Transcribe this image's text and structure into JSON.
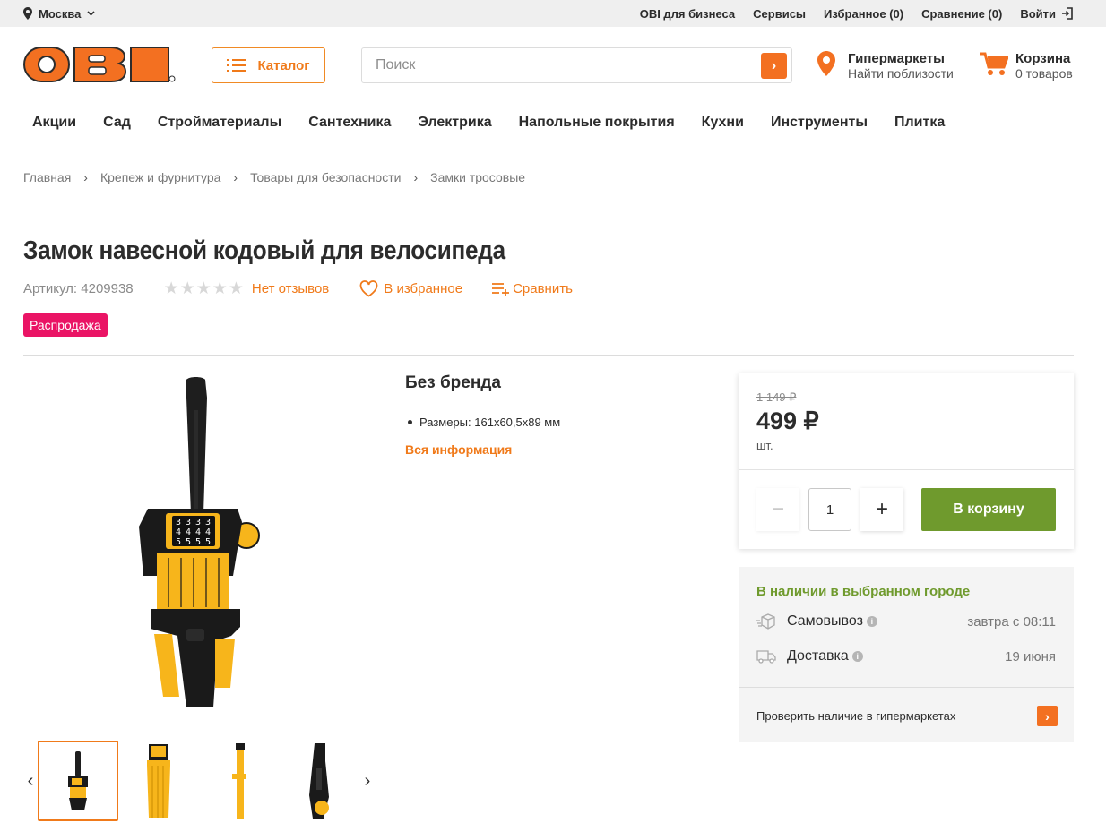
{
  "topbar": {
    "city": "Москва",
    "links": [
      "OBI для бизнеса",
      "Сервисы",
      "Избранное (0)",
      "Сравнение (0)"
    ],
    "login": "Войти"
  },
  "header": {
    "logo_text": "OBI",
    "catalog_label": "Каталог",
    "search_placeholder": "Поиск",
    "stores_title": "Гипермаркеты",
    "stores_sub": "Найти поблизости",
    "cart_title": "Корзина",
    "cart_sub": "0 товаров",
    "accent": "#f37021"
  },
  "nav": [
    "Акции",
    "Сад",
    "Стройматериалы",
    "Сантехника",
    "Электрика",
    "Напольные покрытия",
    "Кухни",
    "Инструменты",
    "Плитка"
  ],
  "breadcrumb": [
    "Главная",
    "Крепеж и фурнитура",
    "Товары для безопасности",
    "Замки тросовые"
  ],
  "product": {
    "title": "Замок навесной кодовый для велосипеда",
    "article": "Артикул: 4209938",
    "rating_stars": 0,
    "reviews": "Нет отзывов",
    "favorite": "В избранное",
    "compare": "Сравнить",
    "badge": "Распродажа",
    "brand": "Без бренда",
    "specs": [
      "Размеры: 161x60,5x89 мм"
    ],
    "all_info": "Вся информация",
    "lock_digits": [
      "3",
      "3",
      "3",
      "3",
      "4",
      "4",
      "4",
      "4",
      "5",
      "5",
      "5",
      "5"
    ]
  },
  "price": {
    "old": "1 149 ₽",
    "new": "499 ₽",
    "unit": "шт.",
    "quantity": "1",
    "add_to_cart": "В корзину",
    "button_color": "#6f9a2d"
  },
  "availability": {
    "title": "В наличии в выбранном городе",
    "pickup_label": "Самовывоз",
    "pickup_value": "завтра с 08:11",
    "delivery_label": "Доставка",
    "delivery_value": "19 июня",
    "check_stores": "Проверить наличие в гипермаркетах"
  }
}
